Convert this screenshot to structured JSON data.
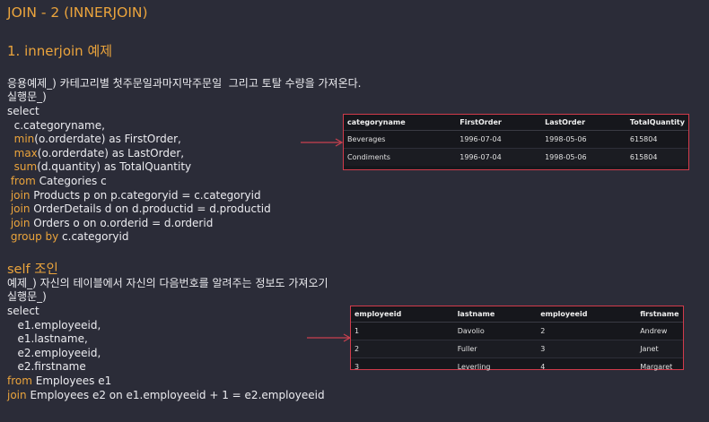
{
  "title": "JOIN - 2 (INNERJOIN)",
  "section1": {
    "heading": "1. innerjoin 예제",
    "desc": "응용예제_) 카테고리별 첫주문일과마지막주문일  그리고 토탈 수량을 가져온다.",
    "run_label": "실행문_)",
    "code": [
      [
        {
          "t": "select"
        }
      ],
      [
        {
          "t": "  c.categoryname,"
        }
      ],
      [
        {
          "t": "  "
        },
        {
          "t": "min",
          "kw": true
        },
        {
          "t": "(o.orderdate) as FirstOrder,"
        }
      ],
      [
        {
          "t": "  "
        },
        {
          "t": "max",
          "kw": true
        },
        {
          "t": "(o.orderdate) as LastOrder,"
        }
      ],
      [
        {
          "t": "  "
        },
        {
          "t": "sum",
          "kw": true
        },
        {
          "t": "(d.quantity) as TotalQuantity"
        }
      ],
      [
        {
          "t": " "
        },
        {
          "t": "from",
          "kw": true
        },
        {
          "t": " Categories c"
        }
      ],
      [
        {
          "t": " "
        },
        {
          "t": "join",
          "kw": true
        },
        {
          "t": " Products p on p.categoryid = c.categoryid"
        }
      ],
      [
        {
          "t": " "
        },
        {
          "t": "join",
          "kw": true
        },
        {
          "t": " OrderDetails d on d.productid = d.productid"
        }
      ],
      [
        {
          "t": " "
        },
        {
          "t": "join",
          "kw": true
        },
        {
          "t": " Orders o on o.orderid = d.orderid"
        }
      ],
      [
        {
          "t": " "
        },
        {
          "t": "group by",
          "kw": true
        },
        {
          "t": " c.categoryid"
        }
      ]
    ],
    "table": {
      "headers": [
        "categoryname",
        "FirstOrder",
        "LastOrder",
        "TotalQuantity"
      ],
      "rows": [
        [
          "Beverages",
          "1996-07-04",
          "1998-05-06",
          "615804"
        ],
        [
          "Condiments",
          "1996-07-04",
          "1998-05-06",
          "615804"
        ]
      ]
    }
  },
  "section2": {
    "heading": "self 조인",
    "desc": "예제_) 자신의 테이블에서 자신의 다음번호를 알려주는 정보도 가져오기",
    "run_label": "실행문_)",
    "code": [
      [
        {
          "t": "select"
        }
      ],
      [
        {
          "t": "   e1.employeeid,"
        }
      ],
      [
        {
          "t": "   e1.lastname,"
        }
      ],
      [
        {
          "t": "   e2.employeeid,"
        }
      ],
      [
        {
          "t": "   e2.firstname"
        }
      ],
      [
        {
          "t": "from",
          "kw": true
        },
        {
          "t": " Employees e1"
        }
      ],
      [
        {
          "t": "join",
          "kw": true
        },
        {
          "t": " Employees e2 on e1.employeeid + 1 = e2.employeeid"
        }
      ]
    ],
    "table": {
      "headers": [
        "employeeid",
        "lastname",
        "employeeid",
        "firstname"
      ],
      "rows": [
        [
          "1",
          "Davolio",
          "2",
          "Andrew"
        ],
        [
          "2",
          "Fuller",
          "3",
          "Janet"
        ],
        [
          "3",
          "Leverling",
          "4",
          "Margaret"
        ]
      ]
    }
  },
  "colors": {
    "accent": "#eba43c",
    "text": "#ececf0",
    "background": "#2b2c38",
    "table_border": "#d23b4b"
  }
}
